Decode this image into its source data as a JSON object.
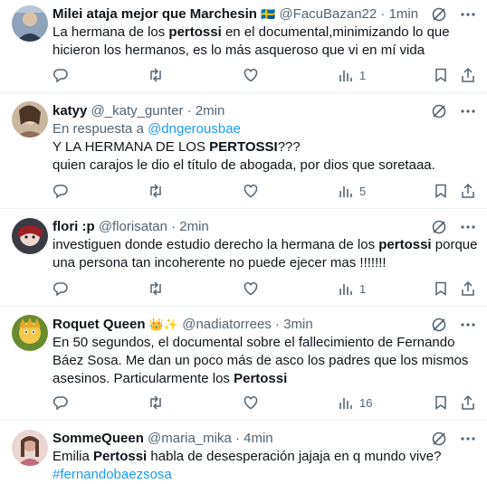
{
  "tweets": [
    {
      "name": "Milei ataja mejor que Marchesin",
      "emoji": "🇸🇪",
      "handle": "@FacuBazan22",
      "time": "1min",
      "reply_prefix": "",
      "reply_handle": "",
      "text": [
        {
          "t": "La hermana de los ",
          "b": false
        },
        {
          "t": "pertossi",
          "b": true
        },
        {
          "t": " en el documental,minimizando lo que hicieron los hermanos, es lo más asqueroso que vi en mí vida",
          "b": false
        }
      ],
      "views": "1"
    },
    {
      "name": "katyy",
      "emoji": "",
      "handle": "@_katy_gunter",
      "time": "2min",
      "reply_prefix": "En respuesta a ",
      "reply_handle": "@dngerousbae",
      "text": [
        {
          "t": "Y LA HERMANA DE LOS ",
          "b": false
        },
        {
          "t": "PERTOSSI",
          "b": true
        },
        {
          "t": "???\nquien carajos le dio el título de abogada, por dios que soretaaa.",
          "b": false
        }
      ],
      "views": "5"
    },
    {
      "name": "flori :p",
      "emoji": "",
      "handle": "@florisatan",
      "time": "2min",
      "reply_prefix": "",
      "reply_handle": "",
      "text": [
        {
          "t": "investiguen donde estudio derecho la hermana de los ",
          "b": false
        },
        {
          "t": "pertossi",
          "b": true
        },
        {
          "t": " porque una persona tan incoherente no puede ejecer mas !!!!!!!",
          "b": false
        }
      ],
      "views": "1"
    },
    {
      "name": "Roquet Queen",
      "emoji": "👑✨",
      "handle": "@nadiatorrees",
      "time": "3min",
      "reply_prefix": "",
      "reply_handle": "",
      "text": [
        {
          "t": "En 50 segundos, el documental sobre el fallecimiento de Fernando Báez Sosa. Me dan un poco más de asco los padres que los mismos asesinos. Particularmente los ",
          "b": false
        },
        {
          "t": "Pertossi",
          "b": true
        }
      ],
      "views": "16"
    },
    {
      "name": "SommeQueen",
      "emoji": "",
      "handle": "@maria_mika",
      "time": "4min",
      "reply_prefix": "",
      "reply_handle": "",
      "text": [
        {
          "t": "Emilia ",
          "b": false
        },
        {
          "t": "Pertossi",
          "b": true
        },
        {
          "t": " habla de desesperación jajaja en q mundo vive?",
          "b": false
        }
      ],
      "hashtag": "#fernandobaezsosa",
      "views": ""
    }
  ],
  "separator": "·",
  "colors": {
    "text": "#0f1419",
    "meta": "#536471",
    "link": "#1d9bf0",
    "border": "#eff3f4"
  }
}
